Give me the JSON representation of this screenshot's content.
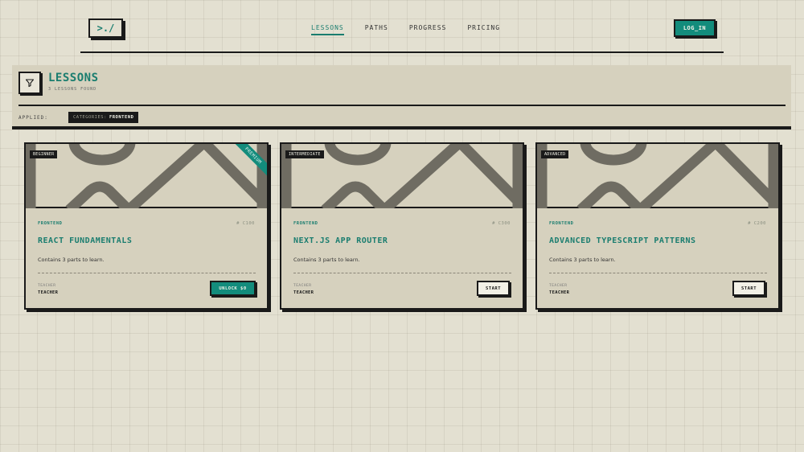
{
  "header": {
    "logo": ">./",
    "nav": [
      "LESSONS",
      "PATHS",
      "PROGRESS",
      "PRICING"
    ],
    "active_nav": "LESSONS",
    "login_label": "LOG_IN"
  },
  "panel": {
    "title": "LESSONS",
    "subtitle": "3 LESSONS FOUND",
    "applied_label": "APPLIED:",
    "chip_key": "CATEGORIES:",
    "chip_value": "FRONTEND"
  },
  "cards": [
    {
      "level": "BEGINNER",
      "ribbon": "PREMIUM",
      "category": "FRONTEND",
      "code": "# C100",
      "title": "REACT FUNDAMENTALS",
      "description": "Contains 3 parts to learn.",
      "teacher_label": "TEACHER",
      "teacher_name": "TEACHER",
      "button": "UNLOCK $0"
    },
    {
      "level": "INTERMEDIATE",
      "category": "FRONTEND",
      "code": "# C300",
      "title": "NEXT.JS APP ROUTER",
      "description": "Contains 3 parts to learn.",
      "teacher_label": "TEACHER",
      "teacher_name": "TEACHER",
      "button": "START"
    },
    {
      "level": "ADVANCED",
      "category": "FRONTEND",
      "code": "# C200",
      "title": "ADVANCED TYPESCRIPT PATTERNS",
      "description": "Contains 3 parts to learn.",
      "teacher_label": "TEACHER",
      "teacher_name": "TEACHER",
      "button": "START"
    }
  ],
  "colors": {
    "accent": "#138c7c",
    "accent_text": "#1a7d6f",
    "background": "#e3e0d1",
    "panel": "#d6d1be",
    "ink": "#1a1a1a",
    "pattern": "#6f6c62"
  },
  "icons": {
    "filter": "filter-icon"
  }
}
